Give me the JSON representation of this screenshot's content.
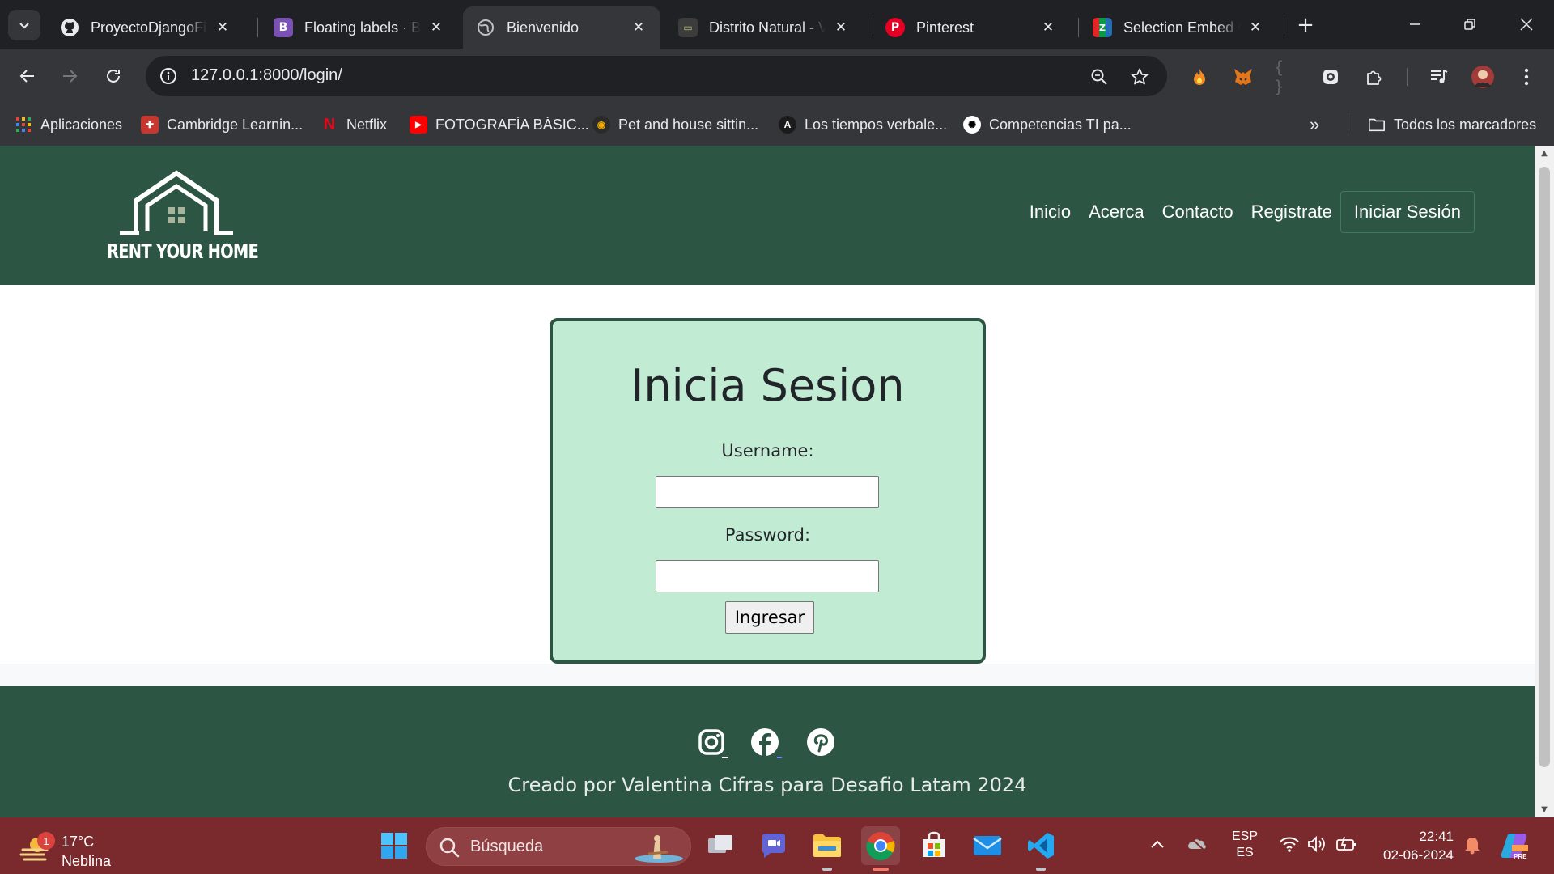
{
  "browser": {
    "tabs": [
      {
        "title": "ProyectoDjangoFin",
        "icon": "github-icon",
        "active": false
      },
      {
        "title": "Floating labels · Bo",
        "icon": "bootstrap-icon",
        "active": false
      },
      {
        "title": "Bienvenido",
        "icon": "globe-icon",
        "active": true
      },
      {
        "title": "Distrito Natural - V",
        "icon": "site-icon",
        "active": false
      },
      {
        "title": "Pinterest",
        "icon": "pinterest-icon",
        "active": false
      },
      {
        "title": "Selection Embed C",
        "icon": "zoho-icon",
        "active": false
      }
    ],
    "new_tab_label": "+",
    "url": "127.0.0.1:8000/login/",
    "bookmarks": [
      {
        "label": "Aplicaciones",
        "icon": "apps-grid-icon"
      },
      {
        "label": "Cambridge Learnin...",
        "icon": "cambridge-icon"
      },
      {
        "label": "Netflix",
        "icon": "netflix-icon"
      },
      {
        "label": "FOTOGRAFÍA BÁSIC...",
        "icon": "youtube-icon"
      },
      {
        "label": "Pet and house sittin...",
        "icon": "site-icon"
      },
      {
        "label": "Los tiempos verbale...",
        "icon": "site-icon"
      },
      {
        "label": "Competencias TI pa...",
        "icon": "openai-icon"
      }
    ],
    "all_bookmarks_label": "Todos los marcadores"
  },
  "site": {
    "logo_text": "RENT YOUR HOME",
    "nav": {
      "inicio": "Inicio",
      "acerca": "Acerca",
      "contacto": "Contacto",
      "registrate": "Registrate",
      "login": "Iniciar Sesión"
    },
    "login": {
      "title": "Inicia Sesion",
      "username_label": "Username:",
      "username_value": "",
      "password_label": "Password:",
      "password_value": "",
      "submit_label": "Ingresar"
    },
    "footer": {
      "social": [
        "instagram-icon",
        "facebook-icon",
        "pinterest-icon"
      ],
      "text": "Creado por Valentina Cifras para Desafio Latam 2024"
    },
    "colors": {
      "header_green": "#2d5543",
      "card_bg": "#c2ebd4"
    }
  },
  "taskbar": {
    "weather": {
      "temp": "17°C",
      "desc": "Neblina",
      "badge": "1"
    },
    "search_placeholder": "Búsqueda",
    "lang_top": "ESP",
    "lang_bottom": "ES",
    "time": "22:41",
    "date": "02-06-2024",
    "color": "#7a2a2d"
  }
}
